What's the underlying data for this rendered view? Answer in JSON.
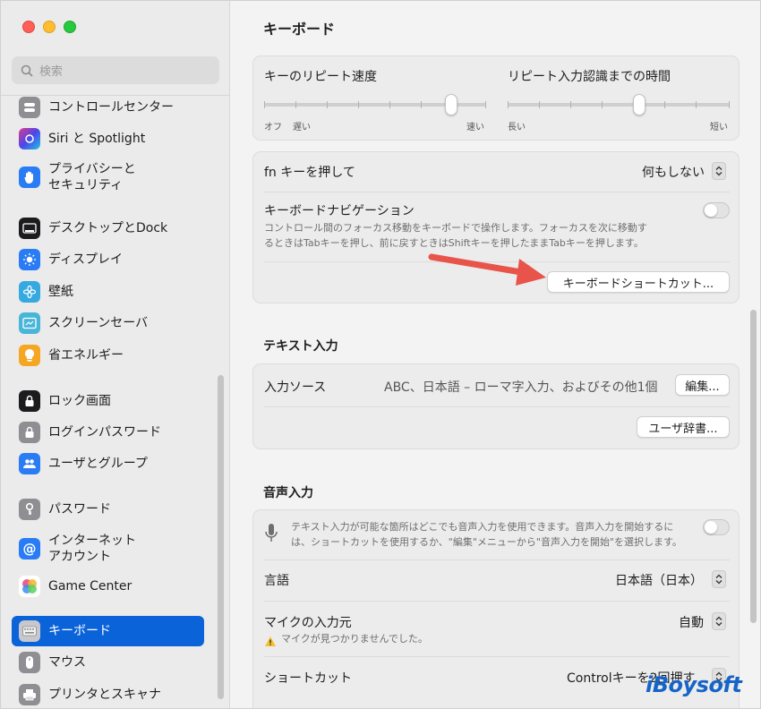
{
  "sidebar": {
    "search_placeholder": "検索",
    "items": [
      {
        "label": "コントロールセンター"
      },
      {
        "label": "Siri と Spotlight"
      },
      {
        "label": "プライバシーと\nセキュリティ"
      },
      {
        "label": "デスクトップとDock"
      },
      {
        "label": "ディスプレイ"
      },
      {
        "label": "壁紙"
      },
      {
        "label": "スクリーンセーバ"
      },
      {
        "label": "省エネルギー"
      },
      {
        "label": "ロック画面"
      },
      {
        "label": "ログインパスワード"
      },
      {
        "label": "ユーザとグループ"
      },
      {
        "label": "パスワード"
      },
      {
        "label": "インターネット\nアカウント"
      },
      {
        "label": "Game Center"
      },
      {
        "label": "キーボード"
      },
      {
        "label": "マウス"
      },
      {
        "label": "プリンタとスキャナ"
      }
    ]
  },
  "main": {
    "title": "キーボード",
    "repeat": {
      "left_title": "キーのリピート速度",
      "left_min": "オフ",
      "left_min2": "遅い",
      "left_max": "速い",
      "right_title": "リピート入力認識までの時間",
      "right_min": "長い",
      "right_max": "短い",
      "left_level": 0.87,
      "right_level": 0.6
    },
    "fn": {
      "label": "fn キーを押して",
      "value": "何もしない"
    },
    "navigation": {
      "label": "キーボードナビゲーション",
      "desc_line1": "コントロール間のフォーカス移動をキーボードで操作します。フォーカスを次に移動す",
      "desc_line2": "るときはTabキーを押し、前に戻すときはShiftキーを押したままTabキーを押します。"
    },
    "shortcuts_button": "キーボードショートカット...",
    "text_input": {
      "title": "テキスト入力",
      "source_label": "入力ソース",
      "source_value": "ABC、日本語 – ローマ字入力、およびその他1個",
      "edit_button": "編集...",
      "dict_button": "ユーザ辞書..."
    },
    "dictation": {
      "title": "音声入力",
      "desc_line1": "テキスト入力が可能な箇所はどこでも音声入力を使用できます。音声入力を開始するに",
      "desc_line2": "は、ショートカットを使用するか、\"編集\"メニューから\"音声入力を開始\"を選択します。",
      "language_label": "言語",
      "language_value": "日本語（日本）",
      "mic_label": "マイクの入力元",
      "mic_value": "自動",
      "mic_warning": "マイクが見つかりませんでした。",
      "shortcut_label": "ショートカット",
      "shortcut_value": "Controlキーを2回押す"
    }
  },
  "watermark": "iBoysoft",
  "colors": {
    "accent": "#0a63d8",
    "arrow": "#e8544a"
  }
}
